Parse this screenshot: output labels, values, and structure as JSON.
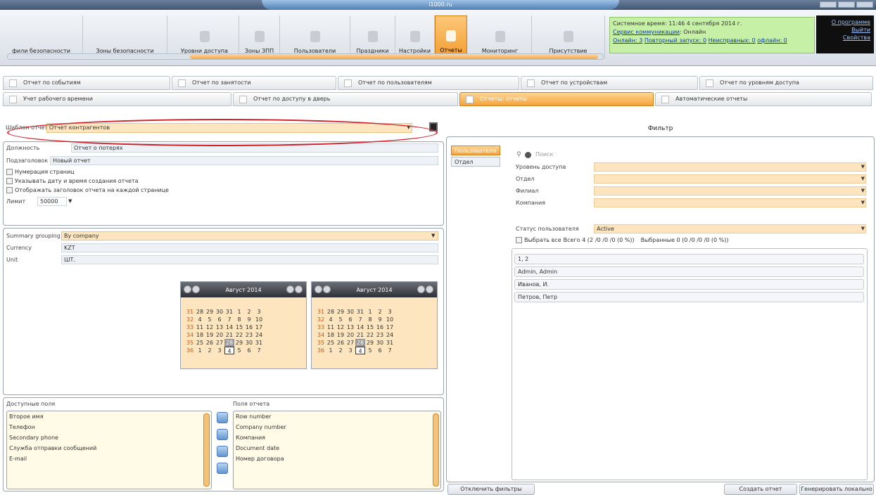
{
  "window": {
    "title": "i1000.ru"
  },
  "toolbar": {
    "items": [
      {
        "label": "фили безопасности",
        "icon": "security-filter-icon"
      },
      {
        "label": "Зоны безопасности",
        "icon": "security-zone-icon"
      },
      {
        "label": "Уровни доступа",
        "icon": "key-icon"
      },
      {
        "label": "Зоны ЗПП",
        "icon": "wrench-icon"
      },
      {
        "label": "Пользователи",
        "icon": "users-icon"
      },
      {
        "label": "Праздники",
        "icon": "holiday-icon"
      },
      {
        "label": "Настройки",
        "icon": "settings-icon"
      },
      {
        "label": "Отчеты",
        "icon": "report-icon",
        "active": true
      },
      {
        "label": "Мониторинг",
        "icon": "monitor-icon"
      },
      {
        "label": "Присутствие",
        "icon": "presence-icon"
      }
    ]
  },
  "status": {
    "line1": "Системное время: 11:46 4 сентября 2014 г.",
    "line2_link": "Сервис коммуникации",
    "line2_text": ": Онлайн",
    "line3": [
      "Онлайн: 3",
      "Повторный запуск: 0",
      "Неисправных: 0",
      "офлайн: 0"
    ]
  },
  "right_links": [
    "О программе",
    "Выйти",
    "Свойства"
  ],
  "tabs_row1": [
    "Отчет по событиям",
    "Отчет по занятости",
    "Отчет по пользователям",
    "Отчет по устройствам",
    "Отчет по уровням доступа"
  ],
  "tabs_row2": [
    "Учет рабочего времени",
    "Отчет по доступу в дверь",
    "Отчеты: отчеты",
    "Автоматические отчеты"
  ],
  "report": {
    "template_label": "Шаблон отчета",
    "template_value": "Отчет контрагентов",
    "position_label": "Должность",
    "position_value": "Отчет о потерях",
    "subtitle_label": "Подзаголовок",
    "subtitle_value": "Новый отчет",
    "checkboxes": [
      "Нумерация страниц",
      "Указывать дату и время создания отчета",
      "Отображать заголовок отчета на каждой странице"
    ],
    "limit_label": "Лимит",
    "limit_value": "50000",
    "summary_label": "Summary grouping",
    "summary_value": "By company",
    "currency_label": "Currency",
    "currency_value": "KZT",
    "unit_label": "Unit",
    "unit_value": "ШТ."
  },
  "calendars": [
    {
      "month": "Август 2014"
    },
    {
      "month": "Август 2014"
    }
  ],
  "calendar_days": [
    [
      "31",
      "28",
      "29",
      "30",
      "31",
      "1",
      "2",
      "3"
    ],
    [
      "32",
      "4",
      "5",
      "6",
      "7",
      "8",
      "9",
      "10"
    ],
    [
      "33",
      "11",
      "12",
      "13",
      "14",
      "15",
      "16",
      "17"
    ],
    [
      "34",
      "18",
      "19",
      "20",
      "21",
      "22",
      "23",
      "24"
    ],
    [
      "35",
      "25",
      "26",
      "27",
      "28",
      "29",
      "30",
      "31"
    ],
    [
      "36",
      "1",
      "2",
      "3",
      "4",
      "5",
      "6",
      "7"
    ]
  ],
  "fields": {
    "available_label": "Доступные поля",
    "available": [
      "Второе имя",
      "Телефон",
      "Secondary phone",
      "Служба отправки сообщений",
      "E-mail"
    ],
    "report_label": "Поля отчета",
    "report": [
      "Row number",
      "Company number",
      "Компания",
      "Document date",
      "Номер договора"
    ]
  },
  "filter": {
    "title": "Фильтр",
    "tabs": [
      "Пользователи",
      "Отдел"
    ],
    "search_placeholder": "Поиск",
    "rows": [
      {
        "label": "Уровень доступа",
        "value": ""
      },
      {
        "label": "Отдел",
        "value": ""
      },
      {
        "label": "Филиал",
        "value": ""
      },
      {
        "label": "Компания",
        "value": ""
      },
      {
        "label": "Статус пользователя",
        "value": "Active"
      }
    ],
    "select_all": "Выбрать все",
    "total": "Всего 4 (2",
    "total_rest": "/0 /0 /0 (0 %))",
    "selected": "Выбранные 0 (0 /0 /0 /0 (0 %))",
    "users": [
      "1, 2",
      "Admin, Admin",
      "Иванов, И.",
      "Петров, Петр"
    ]
  },
  "buttons": {
    "disable_filters": "Отключить фильтры",
    "create": "Создать отчет",
    "generate": "Генерировать локально"
  }
}
